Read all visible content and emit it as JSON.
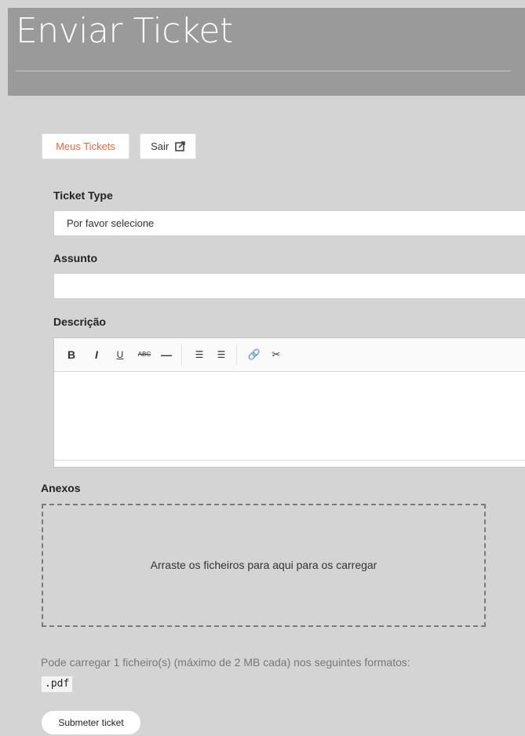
{
  "page": {
    "title": "Enviar Ticket"
  },
  "nav": {
    "my_tickets": "Meus Tickets",
    "logout": "Sair"
  },
  "form": {
    "ticket_type": {
      "label": "Ticket Type",
      "value": "Por favor selecione"
    },
    "subject": {
      "label": "Assunto",
      "value": ""
    },
    "description": {
      "label": "Descrição",
      "toolbar": [
        {
          "name": "bold",
          "glyph": "B"
        },
        {
          "name": "italic",
          "glyph": "I"
        },
        {
          "name": "underline",
          "glyph": "U"
        },
        {
          "name": "strikethrough",
          "glyph": "ABC"
        },
        {
          "name": "horizontal-rule",
          "glyph": "—"
        },
        {
          "name": "bullet-list",
          "glyph": "☰"
        },
        {
          "name": "numbered-list",
          "glyph": "☰"
        },
        {
          "name": "link",
          "glyph": "🔗"
        },
        {
          "name": "unlink",
          "glyph": "✂"
        }
      ]
    },
    "attachments": {
      "label": "Anexos",
      "dropzone_text": "Arraste os ficheiros para aqui para os carregar",
      "help_text": "Pode carregar 1 ficheiro(s) (máximo de 2 MB cada) nos seguintes formatos:",
      "formats": ".pdf"
    },
    "submit": "Submeter ticket"
  },
  "colors": {
    "accent": "#e86a45",
    "header_bg": "#9a9a9a",
    "page_bg": "#d4d4d4"
  }
}
